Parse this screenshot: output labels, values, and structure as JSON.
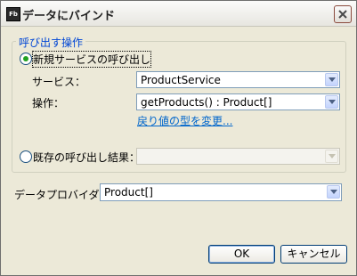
{
  "window": {
    "title": "データにバインド",
    "app_icon_text": "Fb",
    "close_icon": "close-icon"
  },
  "group": {
    "label": "呼び出す操作",
    "new_call_label": "新規サービスの呼び出し",
    "new_call_selected": true,
    "service_label": "サービス：",
    "service_value": "ProductService",
    "operation_label": "操作：",
    "operation_value": "getProducts() : Product[]",
    "change_return_type_link": "戻り値の型を変更...",
    "existing_call_label": "既存の呼び出し結果：",
    "existing_call_selected": false,
    "existing_call_value": ""
  },
  "data_provider": {
    "label": "データプロバイダー：",
    "value": "Product[]"
  },
  "buttons": {
    "ok": "OK",
    "cancel": "キャンセル"
  },
  "colors": {
    "group_label": "#0046d5",
    "link": "#0066cc",
    "radio_selected": "#21a121",
    "dialog_background": "#ece9d8"
  }
}
